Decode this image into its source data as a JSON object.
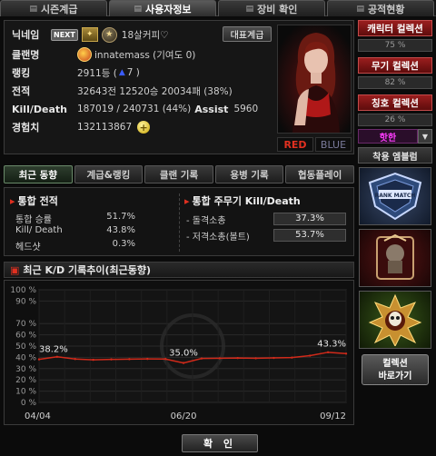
{
  "tabs": [
    {
      "label": "시즌계급"
    },
    {
      "label": "사용자정보"
    },
    {
      "label": "장비 확인"
    },
    {
      "label": "공적현황"
    }
  ],
  "profile": {
    "nickname_label": "닉네임",
    "next_badge": "NEXT",
    "nickname": "18살커피♡",
    "rep_button": "대표계급",
    "clan_label": "클랜명",
    "clan_value": "innatemass (기여도 0)",
    "ranking_label": "랭킹",
    "ranking_value": "2911등 (",
    "ranking_change": "7 )",
    "record_label": "전적",
    "record_value": "32643전 12520승 20034패 (38%)",
    "kd_label": "Kill/Death",
    "kd_value": "187019 / 240731 (44%)",
    "assist_label": "Assist",
    "assist_value": "5960",
    "exp_label": "경험치",
    "exp_value": "132113867",
    "team_red": "RED",
    "team_blue": "BLUE"
  },
  "right_panel": {
    "character_title": "캐릭터 컬렉션",
    "character_pct": "75 %",
    "weapon_title": "무기 컬렉션",
    "weapon_pct": "82 %",
    "title_title": "칭호 컬렉션",
    "title_pct": "26 %",
    "title_select": "핫한",
    "emblem_title": "착용 엠블럼",
    "emblem_rank_text": "RANK MATCH",
    "collection_button_line1": "컬렉션",
    "collection_button_line2": "바로가기"
  },
  "sub_tabs": [
    {
      "label": "최근 동향"
    },
    {
      "label": "계급&랭킹"
    },
    {
      "label": "클랜 기록"
    },
    {
      "label": "용병 기록"
    },
    {
      "label": "협동플레이"
    }
  ],
  "stats": {
    "total_title": "통합 전적",
    "rows": [
      {
        "label": "통합 승률",
        "value": "51.7%"
      },
      {
        "label": "Kill/ Death",
        "value": "43.8%"
      },
      {
        "label": "헤드샷",
        "value": "0.3%"
      }
    ],
    "weapon_title": "통합 주무기 Kill/Death",
    "weapon_rows": [
      {
        "label": "- 돌격소총",
        "value": "37.3%"
      },
      {
        "label": "- 저격소총(볼트)",
        "value": "53.7%"
      }
    ]
  },
  "chart_title": "최근 K/D 기록추이(최근동향)",
  "chart_data": {
    "type": "line",
    "title": "최근 K/D 기록추이(최근동향)",
    "xlabel": "",
    "ylabel": "",
    "ylim": [
      0,
      100
    ],
    "y_ticks": [
      "100 %",
      "90 %",
      "70 %",
      "60 %",
      "50 %",
      "40 %",
      "30 %",
      "20 %",
      "10 %",
      "0 %"
    ],
    "x_ticks": [
      "04/04",
      "06/20",
      "09/12"
    ],
    "annotations": [
      "38.2%",
      "35.0%",
      "43.3%"
    ],
    "grid": true,
    "series": [
      {
        "color": "#d12a1a",
        "x": [
          "04/04",
          "04/14",
          "04/24",
          "05/04",
          "05/14",
          "05/24",
          "06/04",
          "06/12",
          "06/20",
          "06/30",
          "07/10",
          "07/20",
          "07/30",
          "08/10",
          "08/20",
          "08/30",
          "09/05",
          "09/12"
        ],
        "y": [
          38.2,
          40.5,
          38.5,
          37.8,
          38.2,
          38.4,
          38.6,
          38.5,
          35.0,
          39.0,
          39.2,
          39.4,
          39.2,
          39.5,
          39.8,
          41.5,
          44.5,
          43.3
        ]
      }
    ]
  },
  "confirm_button": "확 인"
}
